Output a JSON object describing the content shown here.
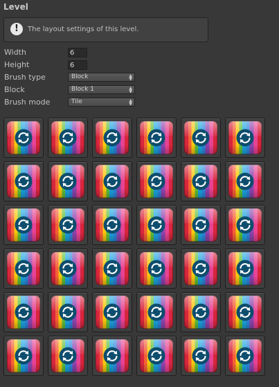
{
  "section": {
    "title": "Level"
  },
  "help": {
    "icon": "exclamation-icon",
    "message": "The layout settings of this level."
  },
  "fields": {
    "width": {
      "label": "Width",
      "value": "6"
    },
    "height": {
      "label": "Height",
      "value": "6"
    },
    "brush_type": {
      "label": "Brush type",
      "value": "Block"
    },
    "block": {
      "label": "Block",
      "value": "Block 1"
    },
    "brush_mode": {
      "label": "Brush mode",
      "value": "Tile"
    }
  },
  "grid": {
    "rows": 6,
    "cols": 6,
    "tile_icon": "rainbow-refresh-block-icon"
  },
  "colors": {
    "background": "#383838",
    "refresh_circle": "#0d4d6e"
  }
}
